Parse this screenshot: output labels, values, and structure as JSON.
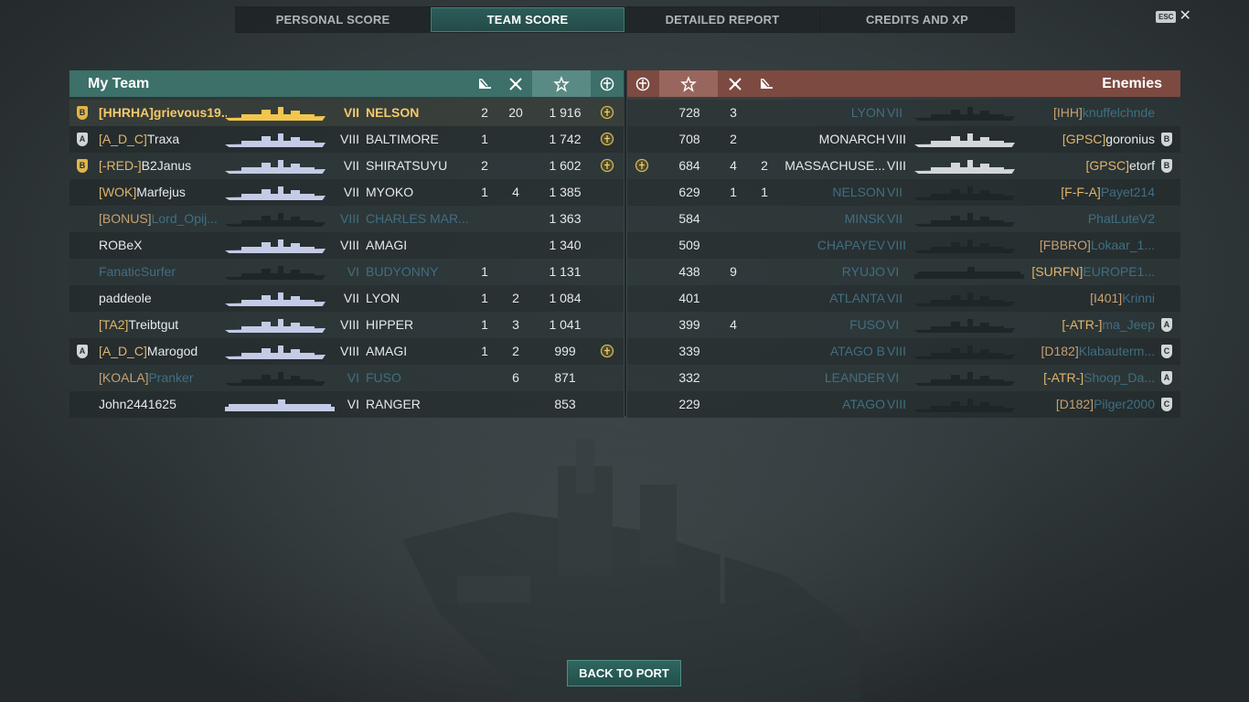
{
  "tabs": [
    "PERSONAL SCORE",
    "TEAM SCORE",
    "DETAILED REPORT",
    "CREDITS AND XP"
  ],
  "active_tab": 1,
  "esc_label": "ESC",
  "close_glyph": "✕",
  "my_team": {
    "title": "My Team",
    "rows": [
      {
        "rank": "B",
        "rank_color": "gold",
        "clan": "[HHRHA]",
        "name": "grievous19...",
        "tier": "VII",
        "ship": "NELSON",
        "c1": "2",
        "c2": "20",
        "score": "1 916",
        "medal": true,
        "state": "self"
      },
      {
        "rank": "A",
        "rank_color": "silver",
        "clan": "[A_D_C]",
        "name": "Traxa",
        "tier": "VIII",
        "ship": "BALTIMORE",
        "c1": "1",
        "c2": "",
        "score": "1 742",
        "medal": true,
        "state": "alive"
      },
      {
        "rank": "B",
        "rank_color": "gold",
        "clan": "[-RED-]",
        "name": "B2Janus",
        "tier": "VII",
        "ship": "SHIRATSUYU",
        "c1": "2",
        "c2": "",
        "score": "1 602",
        "medal": true,
        "state": "alive"
      },
      {
        "rank": "",
        "rank_color": "",
        "clan": "[WOK]",
        "name": "Marfejus",
        "tier": "VII",
        "ship": "MYOKO",
        "c1": "1",
        "c2": "4",
        "score": "1 385",
        "medal": false,
        "state": "alive"
      },
      {
        "rank": "",
        "rank_color": "",
        "clan": "[BONUS]",
        "name": "Lord_Opij...",
        "tier": "VIII",
        "ship": "CHARLES MAR...",
        "c1": "",
        "c2": "",
        "score": "1 363",
        "medal": false,
        "state": "dead"
      },
      {
        "rank": "",
        "rank_color": "",
        "clan": "",
        "name": "ROBeX",
        "tier": "VIII",
        "ship": "AMAGI",
        "c1": "",
        "c2": "",
        "score": "1 340",
        "medal": false,
        "state": "alive"
      },
      {
        "rank": "",
        "rank_color": "",
        "clan": "",
        "name": "FanaticSurfer",
        "tier": "VI",
        "ship": "BUDYONNY",
        "c1": "1",
        "c2": "",
        "score": "1 131",
        "medal": false,
        "state": "dead"
      },
      {
        "rank": "",
        "rank_color": "",
        "clan": "",
        "name": "paddeole",
        "tier": "VII",
        "ship": "LYON",
        "c1": "1",
        "c2": "2",
        "score": "1 084",
        "medal": false,
        "state": "alive"
      },
      {
        "rank": "",
        "rank_color": "",
        "clan": "[TA2]",
        "name": "Treibtgut",
        "tier": "VIII",
        "ship": "HIPPER",
        "c1": "1",
        "c2": "3",
        "score": "1 041",
        "medal": false,
        "state": "alive"
      },
      {
        "rank": "A",
        "rank_color": "silver",
        "clan": "[A_D_C]",
        "name": "Marogod",
        "tier": "VIII",
        "ship": "AMAGI",
        "c1": "1",
        "c2": "2",
        "score": "999",
        "medal": true,
        "state": "alive"
      },
      {
        "rank": "",
        "rank_color": "",
        "clan": "[KOALA]",
        "name": "Pranker",
        "tier": "VI",
        "ship": "FUSO",
        "c1": "",
        "c2": "6",
        "score": "871",
        "medal": false,
        "state": "dead"
      },
      {
        "rank": "",
        "rank_color": "",
        "clan": "",
        "name": "John2441625",
        "tier": "VI",
        "ship": "RANGER",
        "c1": "",
        "c2": "",
        "score": "853",
        "medal": false,
        "state": "alive"
      }
    ]
  },
  "enemies": {
    "title": "Enemies",
    "rows": [
      {
        "medal": false,
        "score": "728",
        "c2": "3",
        "c1": "",
        "ship": "LYON",
        "tier": "VII",
        "clan": "[IHH]",
        "name": "knuffelchnde",
        "rank": "",
        "rank_color": "",
        "state": "dead"
      },
      {
        "medal": false,
        "score": "708",
        "c2": "2",
        "c1": "",
        "ship": "MONARCH",
        "tier": "VIII",
        "clan": "[GPSC]",
        "name": "goronius",
        "rank": "B",
        "rank_color": "silver",
        "state": "alive"
      },
      {
        "medal": true,
        "score": "684",
        "c2": "4",
        "c1": "2",
        "ship": "MASSACHUSE...",
        "tier": "VIII",
        "clan": "[GPSC]",
        "name": "etorf",
        "rank": "B",
        "rank_color": "silver",
        "state": "alive"
      },
      {
        "medal": false,
        "score": "629",
        "c2": "1",
        "c1": "1",
        "ship": "NELSON",
        "tier": "VII",
        "clan": "[F-F-A]",
        "name": "Payet214",
        "rank": "",
        "rank_color": "",
        "state": "dead-w"
      },
      {
        "medal": false,
        "score": "584",
        "c2": "",
        "c1": "",
        "ship": "MINSK",
        "tier": "VII",
        "clan": "",
        "name": "PhatLuteV2",
        "rank": "",
        "rank_color": "",
        "state": "dead"
      },
      {
        "medal": false,
        "score": "509",
        "c2": "",
        "c1": "",
        "ship": "CHAPAYEV",
        "tier": "VIII",
        "clan": "[FBBRO]",
        "name": "Lokaar_1...",
        "rank": "",
        "rank_color": "",
        "state": "dead"
      },
      {
        "medal": false,
        "score": "438",
        "c2": "9",
        "c1": "",
        "ship": "RYUJO",
        "tier": "VI",
        "clan": "[SURFN]",
        "name": "EUROPE1...",
        "rank": "",
        "rank_color": "",
        "state": "dead-w"
      },
      {
        "medal": false,
        "score": "401",
        "c2": "",
        "c1": "",
        "ship": "ATLANTA",
        "tier": "VII",
        "clan": "[I401]",
        "name": "Krinni",
        "rank": "",
        "rank_color": "",
        "state": "dead"
      },
      {
        "medal": false,
        "score": "399",
        "c2": "4",
        "c1": "",
        "ship": "FUSO",
        "tier": "VI",
        "clan": "[-ATR-]",
        "name": "ma_Jeep",
        "rank": "A",
        "rank_color": "silver",
        "state": "dead-w"
      },
      {
        "medal": false,
        "score": "339",
        "c2": "",
        "c1": "",
        "ship": "ATAGO B",
        "tier": "VIII",
        "clan": "[D182]",
        "name": "Klabauterm...",
        "rank": "C",
        "rank_color": "silver",
        "state": "dead"
      },
      {
        "medal": false,
        "score": "332",
        "c2": "",
        "c1": "",
        "ship": "LEANDER",
        "tier": "VI",
        "clan": "[-ATR-]",
        "name": "Shoop_Da...",
        "rank": "A",
        "rank_color": "silver",
        "state": "dead-w"
      },
      {
        "medal": false,
        "score": "229",
        "c2": "",
        "c1": "",
        "ship": "ATAGO",
        "tier": "VIII",
        "clan": "[D182]",
        "name": "Pilger2000",
        "rank": "C",
        "rank_color": "silver",
        "state": "dead"
      }
    ]
  },
  "back_button": "BACK TO PORT"
}
